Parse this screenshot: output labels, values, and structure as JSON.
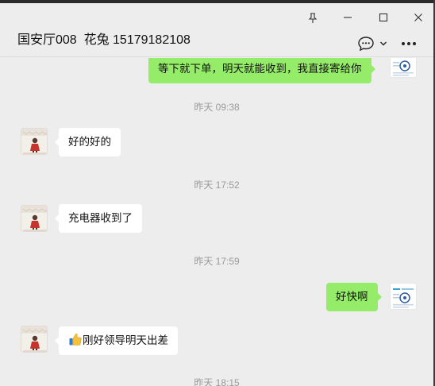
{
  "window": {
    "title": "国安厅008  花兔 15179182108",
    "pin_icon": "pin-icon",
    "minimize_icon": "minimize-icon",
    "maximize_icon": "maximize-icon",
    "close_icon": "close-icon",
    "chat_info_icon": "chat-bubble-icon",
    "dropdown_icon": "chevron-down-icon",
    "more_icon": "more-icon"
  },
  "messages": [
    {
      "type": "out",
      "text": "等下就下单，明天就能收到，我直接寄给你"
    },
    {
      "type": "time",
      "text": "昨天 09:38"
    },
    {
      "type": "in",
      "text": "好的好的"
    },
    {
      "type": "time",
      "text": "昨天 17:52"
    },
    {
      "type": "in",
      "text": "充电器收到了"
    },
    {
      "type": "time",
      "text": "昨天 17:59"
    },
    {
      "type": "out",
      "text": "好快啊"
    },
    {
      "type": "in",
      "text": "刚好领导明天出差",
      "emoji": "👍"
    },
    {
      "type": "time",
      "text": "昨天 18:15"
    }
  ],
  "colors": {
    "background": "#ededed",
    "outgoing_bubble": "#95ec69",
    "incoming_bubble": "#ffffff",
    "timestamp": "#9a9a9a"
  }
}
